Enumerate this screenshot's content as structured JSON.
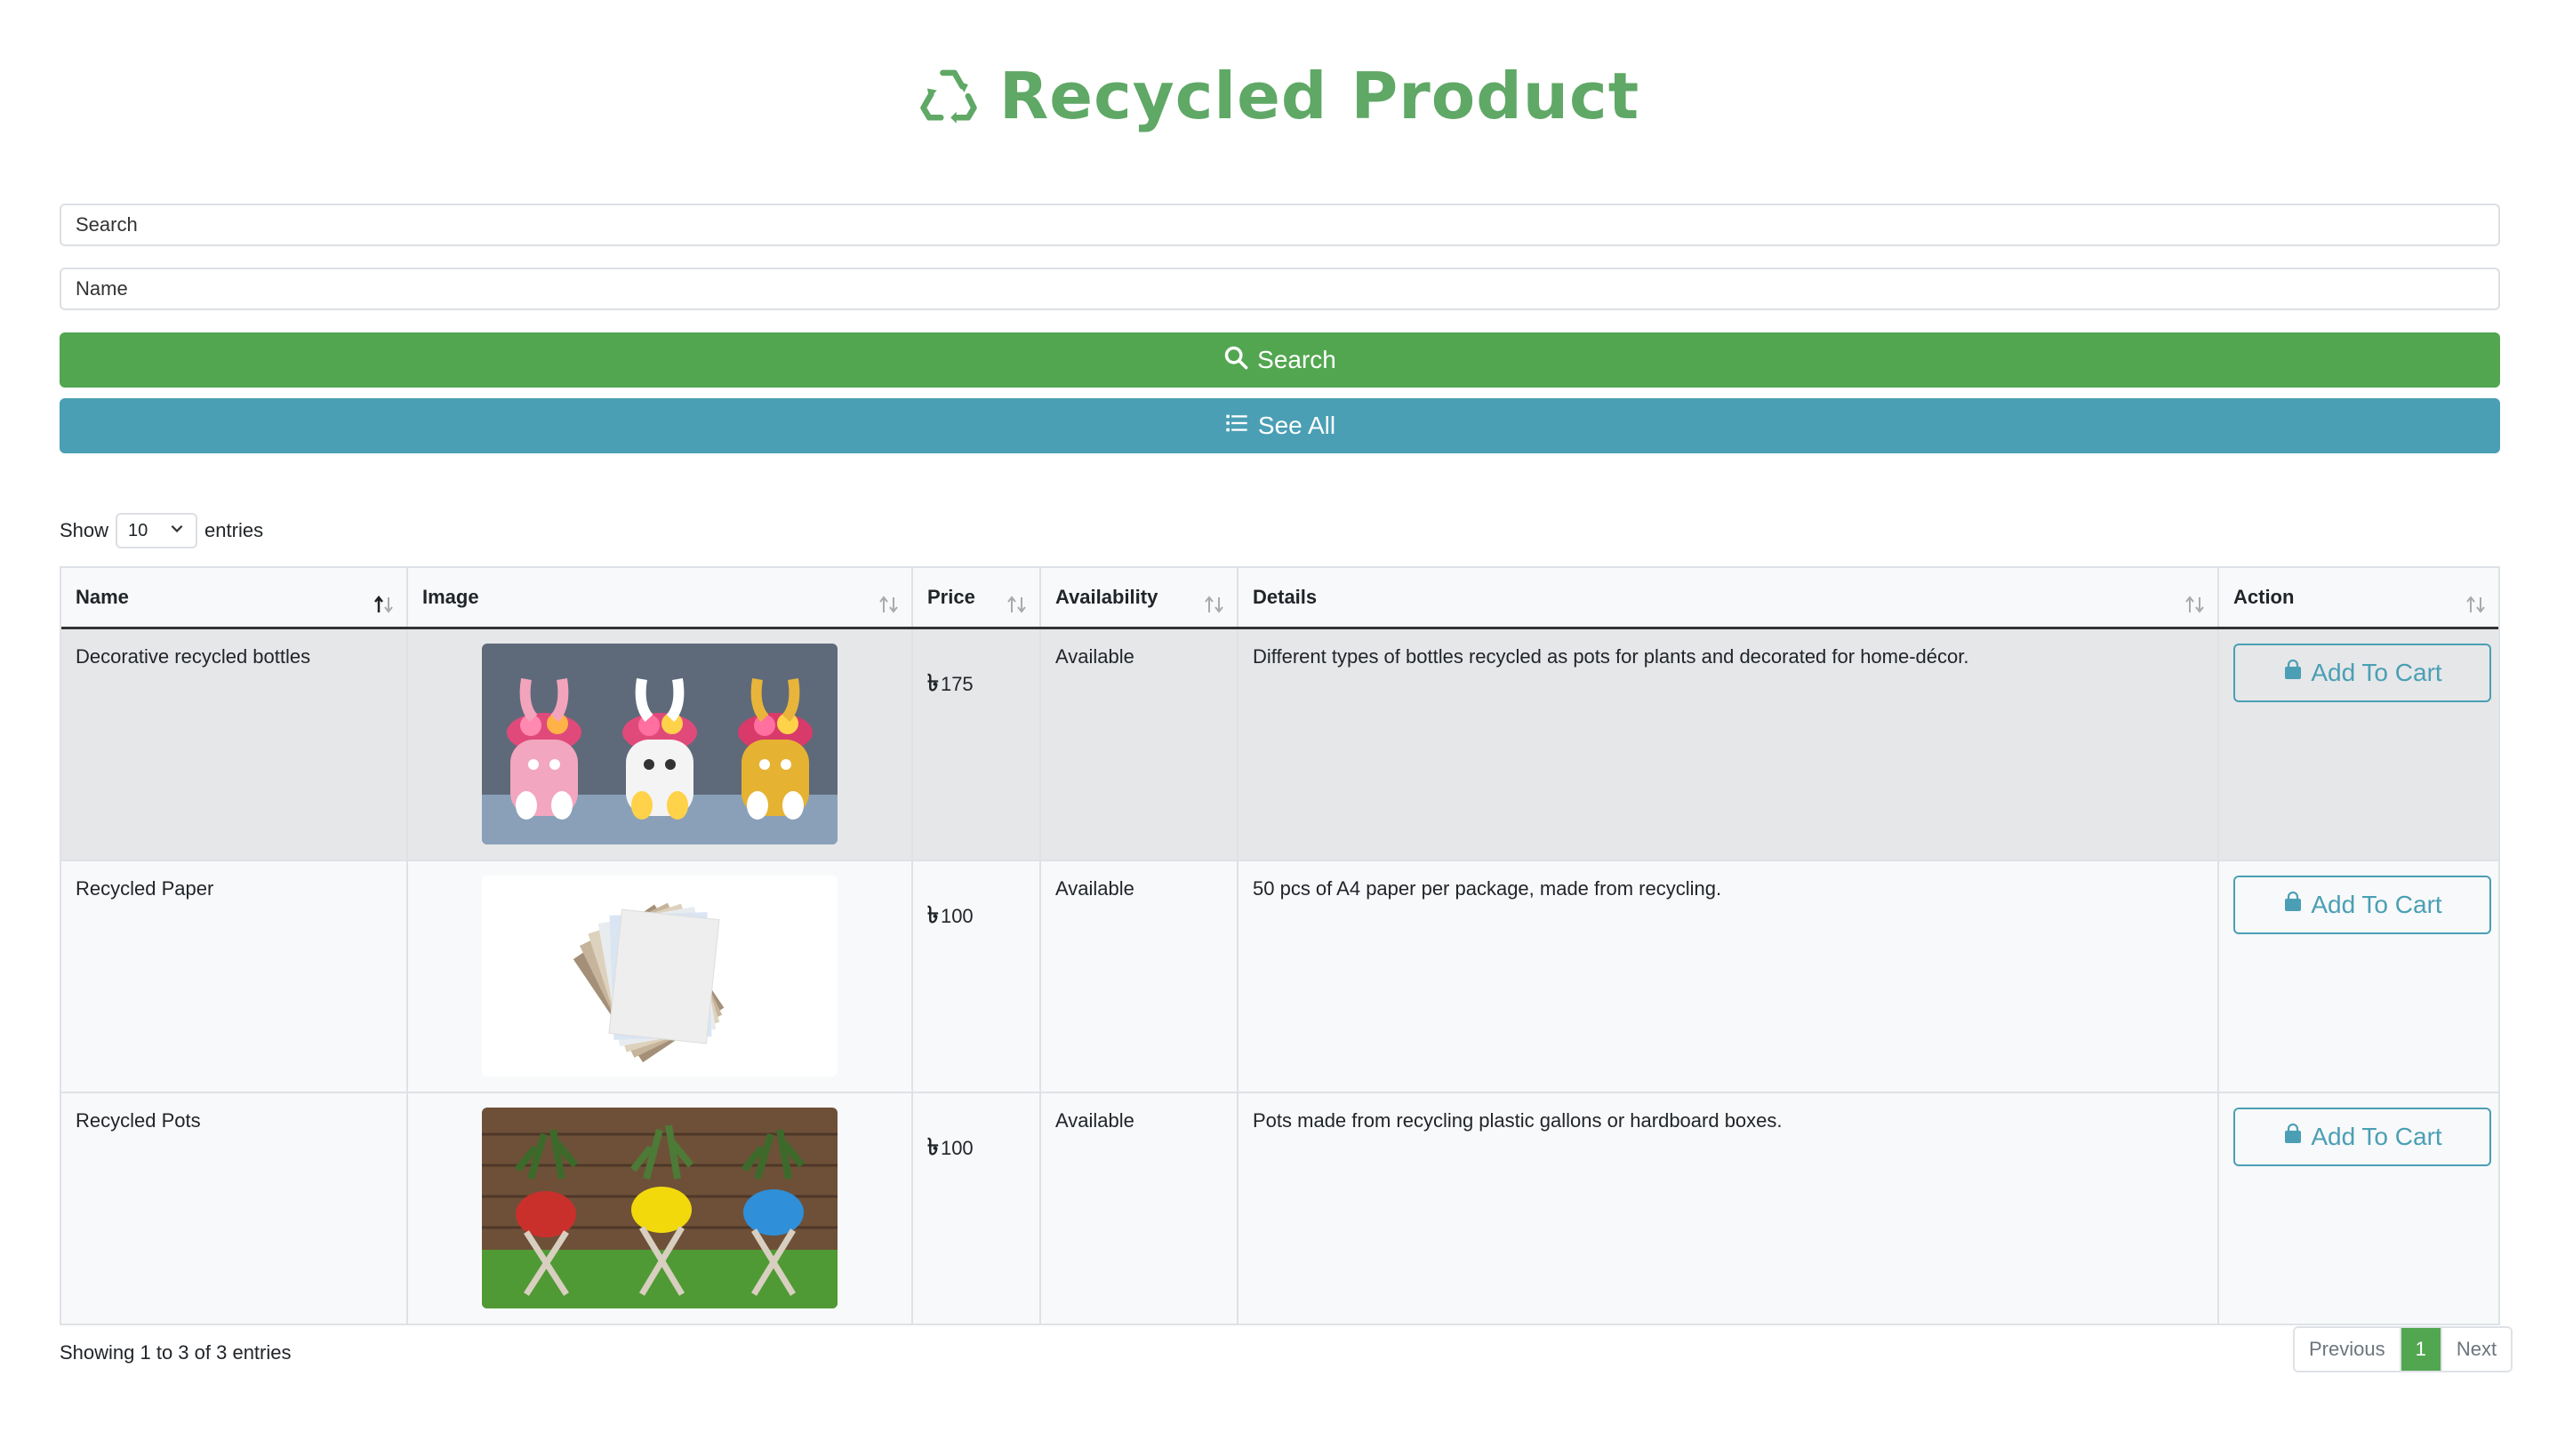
{
  "header": {
    "title": "Recycled Product",
    "icon": "recycle-icon",
    "color": "#5fa866"
  },
  "search": {
    "placeholder": "Search",
    "name_placeholder": "Name",
    "search_label": "Search",
    "see_all_label": "See All"
  },
  "colors": {
    "success": "#52a650",
    "info": "#4a9fb4"
  },
  "length": {
    "show": "Show",
    "value": "10",
    "entries": "entries"
  },
  "table": {
    "columns": [
      "Name",
      "Image",
      "Price",
      "Availability",
      "Details",
      "Action"
    ],
    "sorted_column": "Name",
    "currency_symbol": "৳",
    "rows": [
      {
        "name": "Decorative recycled bottles",
        "image": "decorated-bottle-pots-image",
        "price": "175",
        "availability": "Available",
        "details": "Different types of bottles recycled as pots for plants and decorated for home-décor.",
        "action": "Add To Cart"
      },
      {
        "name": "Recycled Paper",
        "image": "recycled-paper-image",
        "price": "100",
        "availability": "Available",
        "details": "50 pcs of A4 paper per package, made from recycling.",
        "action": "Add To Cart"
      },
      {
        "name": "Recycled Pots",
        "image": "recycled-pots-image",
        "price": "100",
        "availability": "Available",
        "details": "Pots made from recycling plastic gallons or hardboard boxes.",
        "action": "Add To Cart"
      }
    ]
  },
  "footer": {
    "info": "Showing 1 to 3 of 3 entries",
    "previous": "Previous",
    "page": "1",
    "next": "Next"
  }
}
